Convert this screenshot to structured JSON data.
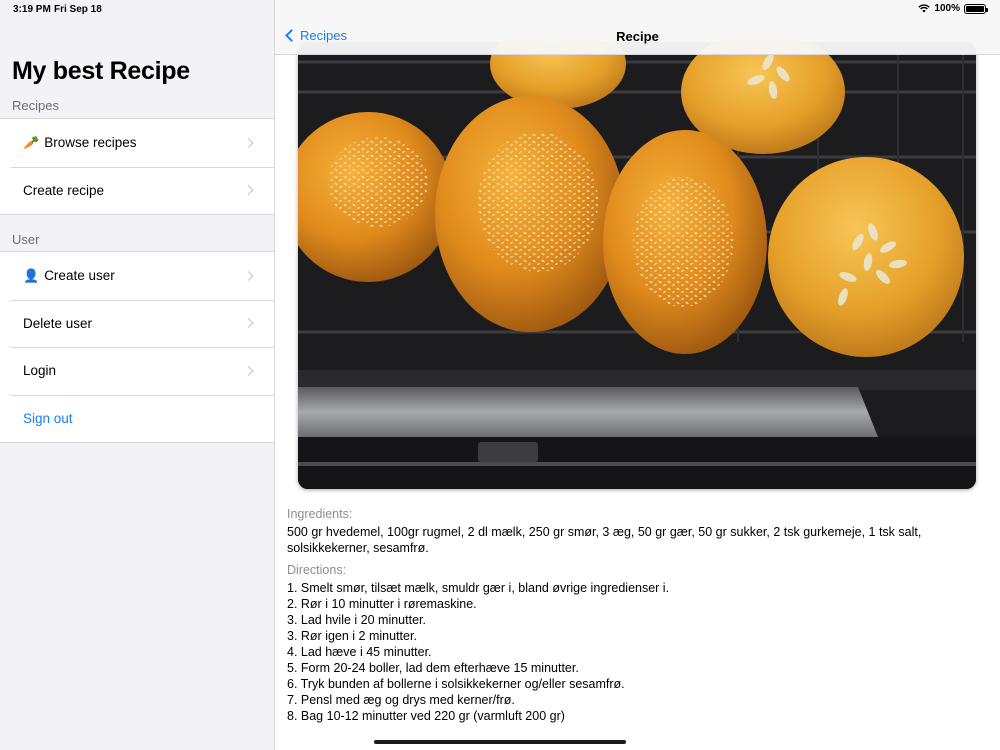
{
  "status": {
    "time": "3:19 PM",
    "date": "Fri Sep 18",
    "battery": "100%"
  },
  "sidebar": {
    "title": "My best Recipe",
    "sections": {
      "recipes_header": "Recipes",
      "user_header": "User"
    },
    "recipes_items": [
      {
        "emoji": "🥕",
        "label": "Browse recipes"
      },
      {
        "label": "Create recipe"
      }
    ],
    "user_items": [
      {
        "emoji": "👤",
        "label": "Create user"
      },
      {
        "label": "Delete user"
      },
      {
        "label": "Login"
      },
      {
        "label": "Sign out"
      }
    ]
  },
  "navbar": {
    "back_label": "Recipes",
    "title": "Recipe"
  },
  "recipe": {
    "ingredients_label": "Ingredients:",
    "ingredients": "500 gr hvedemel, 100gr rugmel, 2 dl mælk, 250 gr smør, 3 æg, 50 gr gær, 50 gr sukker, 2 tsk gurkemeje, 1 tsk salt,\nsolsikkekerner, sesamfrø.",
    "directions_label": "Directions:",
    "directions": "1. Smelt smør, tilsæt mælk, smuldr gær i, bland øvrige ingredienser i.\n2. Rør i 10 minutter i røremaskine.\n3. Lad hvile i 20 minutter.\n3. Rør igen i 2 minutter.\n4. Lad hæve i 45 minutter.\n5. Form 20-24 boller, lad dem efterhæve 15 minutter.\n6. Tryk bunden af bollerne i solsikkekerner og/eller sesamfrø.\n7. Pensl med æg og drys med kerner/frø.\n8. Bag 10-12 minutter ved 220 gr (varmluft 200 gr)"
  },
  "colors": {
    "accent": "#1a7cf5",
    "sidebar_bg": "#f2f2f7",
    "secondary_text": "#8e8e93"
  },
  "icons": [
    "wifi-icon",
    "battery-icon",
    "chevron-right-icon",
    "back-chevron-icon"
  ]
}
